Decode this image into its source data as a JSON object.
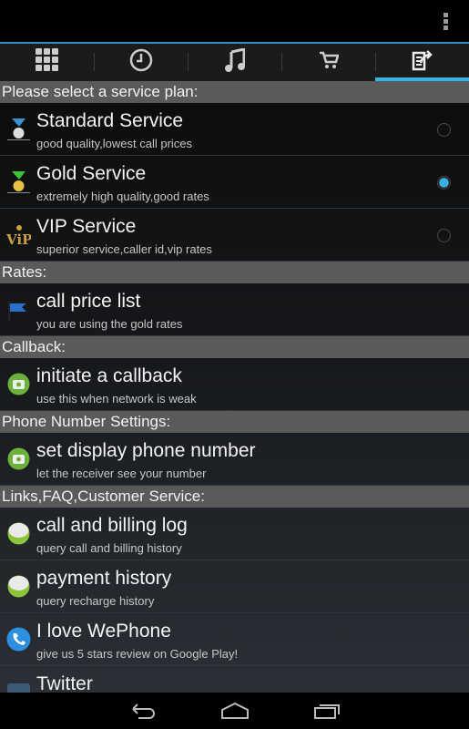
{
  "tabs": [
    {
      "icon": "dialpad-icon"
    },
    {
      "icon": "clock-icon"
    },
    {
      "icon": "music-icon"
    },
    {
      "icon": "cart-icon"
    },
    {
      "icon": "edit-share-icon",
      "active": true
    }
  ],
  "sections": [
    {
      "header": "Please select a service plan:",
      "items": [
        {
          "title": "Standard Service",
          "subtitle": "good quality,lowest call prices",
          "icon": "silver-medal-icon",
          "radio": false
        },
        {
          "title": "Gold Service",
          "subtitle": "extremely high quality,good rates",
          "icon": "gold-medal-icon",
          "radio": true
        },
        {
          "title": "VIP Service",
          "subtitle": "superior service,caller id,vip rates",
          "icon": "vip-icon",
          "radio": false
        }
      ]
    },
    {
      "header": "Rates:",
      "items": [
        {
          "title": "call price list",
          "subtitle": "you are using the gold rates",
          "icon": "flag-icon"
        }
      ]
    },
    {
      "header": "Callback:",
      "items": [
        {
          "title": "initiate a callback",
          "subtitle": "use this when network is weak",
          "icon": "green-phone-icon"
        }
      ]
    },
    {
      "header": "Phone Number Settings:",
      "items": [
        {
          "title": "set display phone number",
          "subtitle": "let the receiver see your number",
          "icon": "green-phone-icon"
        }
      ]
    },
    {
      "header": "Links,FAQ,Customer Service:",
      "items": [
        {
          "title": "call and billing log",
          "subtitle": "query call and billing history",
          "icon": "green-ball-icon"
        },
        {
          "title": "payment history",
          "subtitle": "query recharge history",
          "icon": "green-ball-icon"
        },
        {
          "title": "I love WePhone",
          "subtitle": "give us 5 stars review on Google Play!",
          "icon": "blue-phone-icon"
        },
        {
          "title": "Twitter",
          "subtitle": "",
          "icon": "twitter-icon"
        }
      ]
    }
  ],
  "colors": {
    "accent": "#33b5e5",
    "header_bg": "#5a5a5a"
  }
}
